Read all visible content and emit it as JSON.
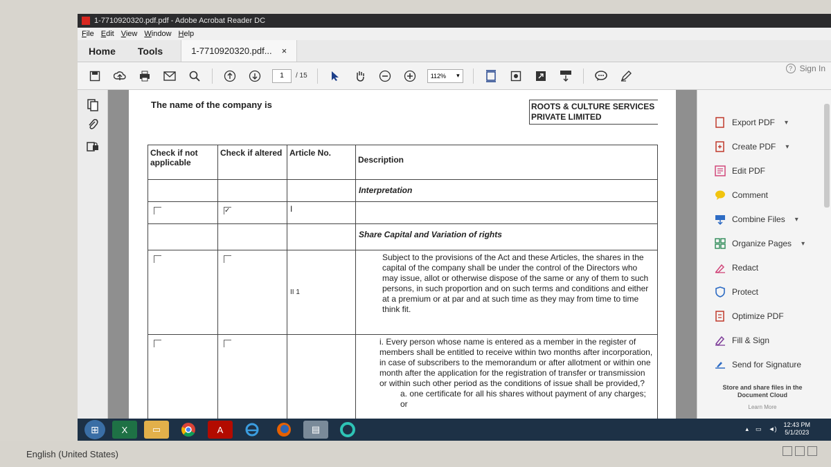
{
  "window": {
    "title": "1-7710920320.pdf.pdf - Adobe Acrobat Reader DC"
  },
  "menu": {
    "items": [
      "File",
      "Edit",
      "View",
      "Window",
      "Help"
    ]
  },
  "nav": {
    "home": "Home",
    "tools": "Tools",
    "doc_tab": "1-7710920320.pdf...",
    "close_glyph": "×"
  },
  "toolbar": {
    "page_current": "1",
    "page_total": "/ 15",
    "zoom": "112%",
    "sign_in": "Sign In",
    "help_glyph": "?",
    "icons": [
      "save-icon",
      "upload-icon",
      "print-icon",
      "email-icon",
      "search-icon",
      "page-up-icon",
      "page-down-icon",
      "select-arrow-icon",
      "hand-icon",
      "zoom-out-icon",
      "zoom-in-icon",
      "fit-page-icon",
      "rotate-icon",
      "fullscreen-icon",
      "scroll-icon",
      "comment-icon",
      "pen-icon"
    ]
  },
  "document": {
    "company_label": "The name of the company is",
    "company_name_line1": "ROOTS & CULTURE SERVICES",
    "company_name_line2": "PRIVATE LIMITED",
    "headers": {
      "not_applicable": "Check if not applicable",
      "altered": "Check if altered",
      "article_no": "Article No.",
      "description": "Description"
    },
    "sections": {
      "interpretation": "Interpretation",
      "share_capital": "Share Capital and Variation of rights"
    },
    "rows": {
      "row1_article": "I",
      "row1_check": "✓",
      "row2_article": "II 1",
      "row2_text": "Subject to the provisions of the Act and these Articles, the shares in the capital of the company shall be under the control of the Directors who may issue, allot or otherwise dispose of the same or any of them to such persons, in such proportion and on such terms and conditions and either at a premium or at par and at such time as they may from time to time think fit.",
      "row3_text": "i.  Every person whose name is entered as a member in the register of members shall be entitled to receive within two months after incorporation, in case of subscribers to the memorandum or after allotment or within one month after the application for the registration of transfer or transmission or within such other period as the conditions of issue shall be provided,?",
      "row3_sub": "a.  one certificate for all his shares without payment of any charges; or"
    }
  },
  "tools_pane": {
    "items": [
      {
        "label": "Export PDF",
        "icon": "export-pdf-icon",
        "chevron": true
      },
      {
        "label": "Create PDF",
        "icon": "create-pdf-icon",
        "chevron": true
      },
      {
        "label": "Edit PDF",
        "icon": "edit-pdf-icon",
        "chevron": false
      },
      {
        "label": "Comment",
        "icon": "comment-icon",
        "chevron": false
      },
      {
        "label": "Combine Files",
        "icon": "combine-files-icon",
        "chevron": true
      },
      {
        "label": "Organize Pages",
        "icon": "organize-pages-icon",
        "chevron": true
      },
      {
        "label": "Redact",
        "icon": "redact-icon",
        "chevron": false
      },
      {
        "label": "Protect",
        "icon": "protect-icon",
        "chevron": false
      },
      {
        "label": "Optimize PDF",
        "icon": "optimize-pdf-icon",
        "chevron": false
      },
      {
        "label": "Fill & Sign",
        "icon": "fill-sign-icon",
        "chevron": false
      },
      {
        "label": "Send for Signature",
        "icon": "send-signature-icon",
        "chevron": false
      }
    ],
    "cloud_line1": "Store and share files in the",
    "cloud_line2": "Document Cloud",
    "learn_more": "Learn More"
  },
  "taskbar": {
    "apps": [
      "start-icon",
      "excel-icon",
      "folder-icon",
      "chrome-icon",
      "acrobat-icon",
      "ie-icon",
      "firefox-icon",
      "notepad-icon",
      "edge-icon"
    ],
    "time": "12:43 PM",
    "date": "5/1/2023"
  },
  "language_bar": {
    "label": "English (United States)"
  },
  "colors": {
    "acrobat_red": "#d8261f",
    "taskbar": "#1d3146",
    "page": "#ffffff"
  }
}
